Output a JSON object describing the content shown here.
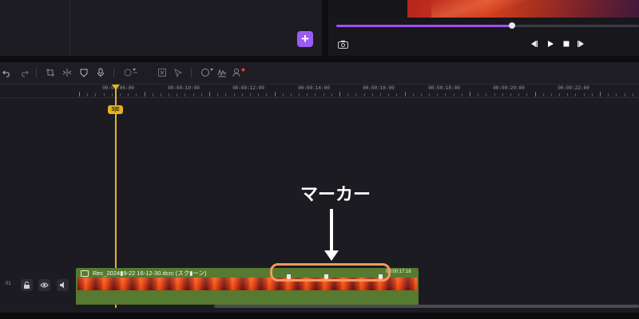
{
  "colors": {
    "accent": "#a74ff0",
    "playhead": "#e4b321",
    "clip_green": "#567a2f",
    "annotation_border": "#f19a5a",
    "annotation_text": "#ffffff"
  },
  "media": {
    "add_button": "+"
  },
  "player": {
    "progress": 0.58,
    "icons": [
      "camera-icon",
      "prev-frame-icon",
      "play-icon",
      "stop-icon",
      "next-frame-icon"
    ]
  },
  "toolbar": {
    "icons": [
      "undo-icon",
      "redo-icon",
      "crop-icon",
      "split-icon",
      "mask-icon",
      "mic-icon",
      "premium-ai-icon",
      "freeze-frame-icon",
      "motion-tracking-icon",
      "color-match-icon",
      "audio-stretch-icon",
      "voice-changer-icon"
    ]
  },
  "ruler": {
    "labels": [
      "00:00:06:00",
      "00:00:10:00",
      "00:00:12:00",
      "00:00:14:00",
      "00:00:16:00",
      "00:00:18:00",
      "00:00:20:00",
      "00:00:22:00"
    ]
  },
  "playhead": {
    "handle_label": "3|E"
  },
  "annotation": {
    "text": "マーカー"
  },
  "track": {
    "number": "01",
    "controls": [
      "lock-icon",
      "eye-icon",
      "speaker-icon"
    ],
    "clip": {
      "title": "Rec_2024▮9-22 16-12-30.dcrc (スク▮ーン)",
      "duration": "00:00:17:16",
      "marker_count": 3
    }
  }
}
